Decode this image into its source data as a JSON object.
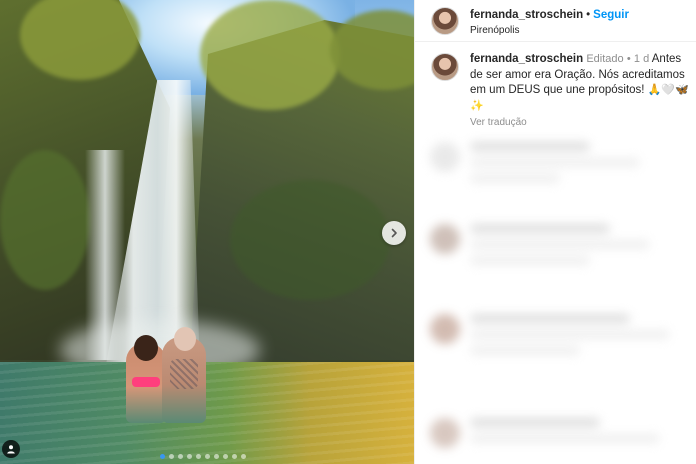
{
  "post": {
    "username": "fernanda_stroschein",
    "separator": "•",
    "follow_label": "Seguir",
    "location": "Pirenópolis"
  },
  "caption": {
    "username": "fernanda_stroschein",
    "edited_label": "Editado",
    "separator": "•",
    "time_ago": "1 d",
    "text": "Antes de ser amor era Oração. Nós acreditamos em um DEUS que une propósitos!",
    "emojis": "🙏🤍🦋✨",
    "see_translation": "Ver tradução"
  },
  "carousel": {
    "total_slides": 10,
    "active_slide": 1
  },
  "colors": {
    "follow_blue": "#0095f6",
    "active_dot": "#3897f0",
    "muted_text": "#8e8e8e"
  }
}
